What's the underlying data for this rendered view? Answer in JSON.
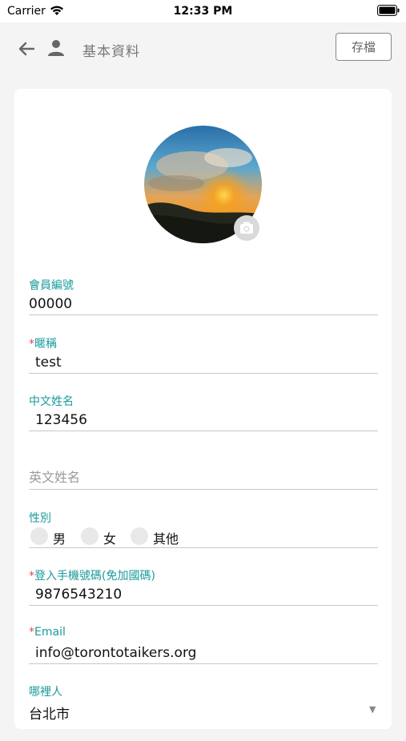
{
  "status_bar": {
    "carrier": "Carrier",
    "time": "12:33 PM"
  },
  "header": {
    "title": "基本資料",
    "save_label": "存檔"
  },
  "profile": {
    "member_id": {
      "label": "會員編號",
      "value": "00000"
    },
    "nickname": {
      "label": "暱稱",
      "value": "test",
      "required": true
    },
    "chinese_name": {
      "label": "中文姓名",
      "value": "123456"
    },
    "english_name": {
      "placeholder": "英文姓名"
    },
    "gender": {
      "label": "性別",
      "options": [
        "男",
        "女",
        "其他"
      ],
      "selected": null
    },
    "phone": {
      "label": "登入手機號碼(免加國碼)",
      "value": "9876543210",
      "required": true
    },
    "email": {
      "label": "Email",
      "value": "info@torontotaikers.org",
      "required": true
    },
    "region": {
      "label": "哪裡人",
      "value": "台北市"
    }
  },
  "colors": {
    "label": "#1a9a9a",
    "required": "#e24a4a",
    "background": "#f4f4f4"
  },
  "icons": [
    "wifi-icon",
    "battery-icon",
    "back-arrow-icon",
    "person-icon",
    "camera-icon",
    "dropdown-arrow-icon"
  ]
}
